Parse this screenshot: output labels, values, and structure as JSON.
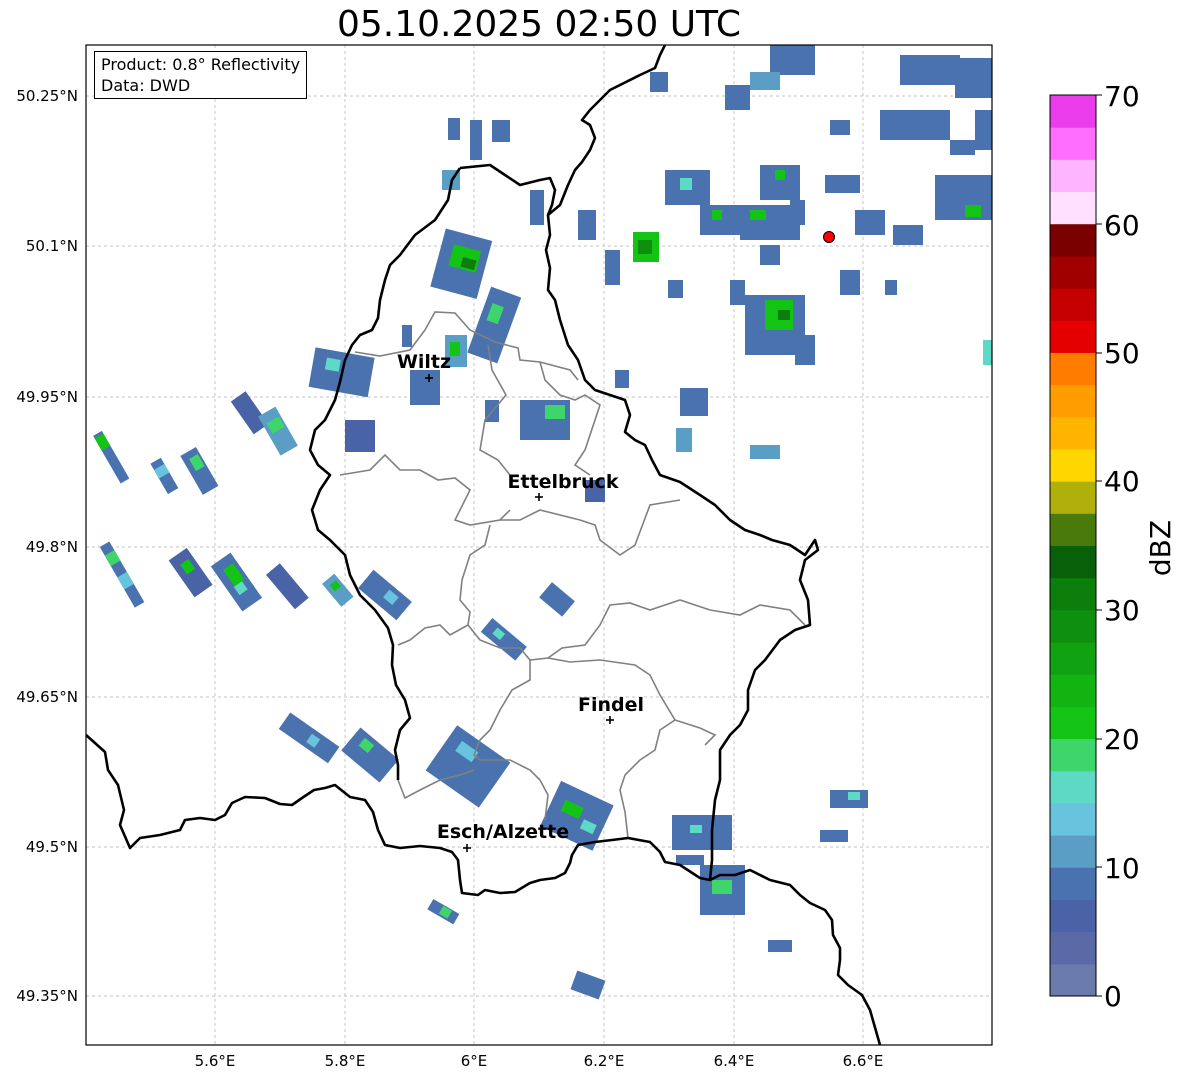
{
  "title": "05.10.2025 02:50 UTC",
  "info": {
    "product": "Product: 0.8° Reflectivity",
    "data": "Data: DWD"
  },
  "axes": {
    "lon_ticks": [
      "5.6°E",
      "5.8°E",
      "6°E",
      "6.2°E",
      "6.4°E",
      "6.6°E"
    ],
    "lat_ticks": [
      "50.25°N",
      "50.1°N",
      "49.95°N",
      "49.8°N",
      "49.65°N",
      "49.5°N",
      "49.35°N"
    ]
  },
  "cities": [
    {
      "name": "Wiltz"
    },
    {
      "name": "Ettelbruck"
    },
    {
      "name": "Findel"
    },
    {
      "name": "Esch/Alzette"
    }
  ],
  "colorbar": {
    "label": "dBZ",
    "ticks": [
      "0",
      "10",
      "20",
      "30",
      "40",
      "50",
      "60",
      "70"
    ],
    "colors": [
      "#6a7aaa",
      "#5a6aa6",
      "#4a62a6",
      "#4a72ae",
      "#5a9ec6",
      "#68c4de",
      "#5ed9c6",
      "#3ed66a",
      "#14c414",
      "#12b412",
      "#10a210",
      "#0e900e",
      "#0c7e0c",
      "#086008",
      "#4a7a0a",
      "#b0b00a",
      "#ffd700",
      "#ffb400",
      "#ff9c00",
      "#ff7c00",
      "#e40000",
      "#c40000",
      "#a00000",
      "#7a0000",
      "#ffe0ff",
      "#ffb4ff",
      "#ff6eff",
      "#ea3cea"
    ]
  },
  "colors": {
    "border_national": "#000000",
    "border_canton": "#808080",
    "grid": "#b0b0b0"
  },
  "icons": {
    "city_marker": "plus-marker-icon",
    "radar_site": "red-dot-icon"
  }
}
